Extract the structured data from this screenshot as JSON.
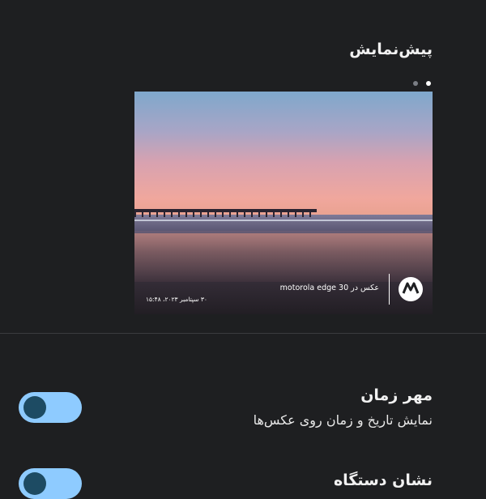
{
  "preview": {
    "title": "پیش‌نمایش",
    "dots": [
      true,
      false
    ],
    "watermark": {
      "brand_icon": "motorola-logo-icon",
      "device_text": "عکس در motorola edge 30",
      "date_text": "۳۰ سپتامبر ۲۰۲۳، ۱۵:۴۸"
    }
  },
  "settings": {
    "timestamp": {
      "title": "مهر زمان",
      "subtitle": "نمایش تاریخ و زمان روی عکس‌ها",
      "enabled": true
    },
    "device_mark": {
      "title": "نشان دستگاه",
      "enabled": true
    }
  },
  "colors": {
    "background": "#1e1f21",
    "toggle_track": "#8ecbff",
    "toggle_knob": "#1d4b63"
  }
}
